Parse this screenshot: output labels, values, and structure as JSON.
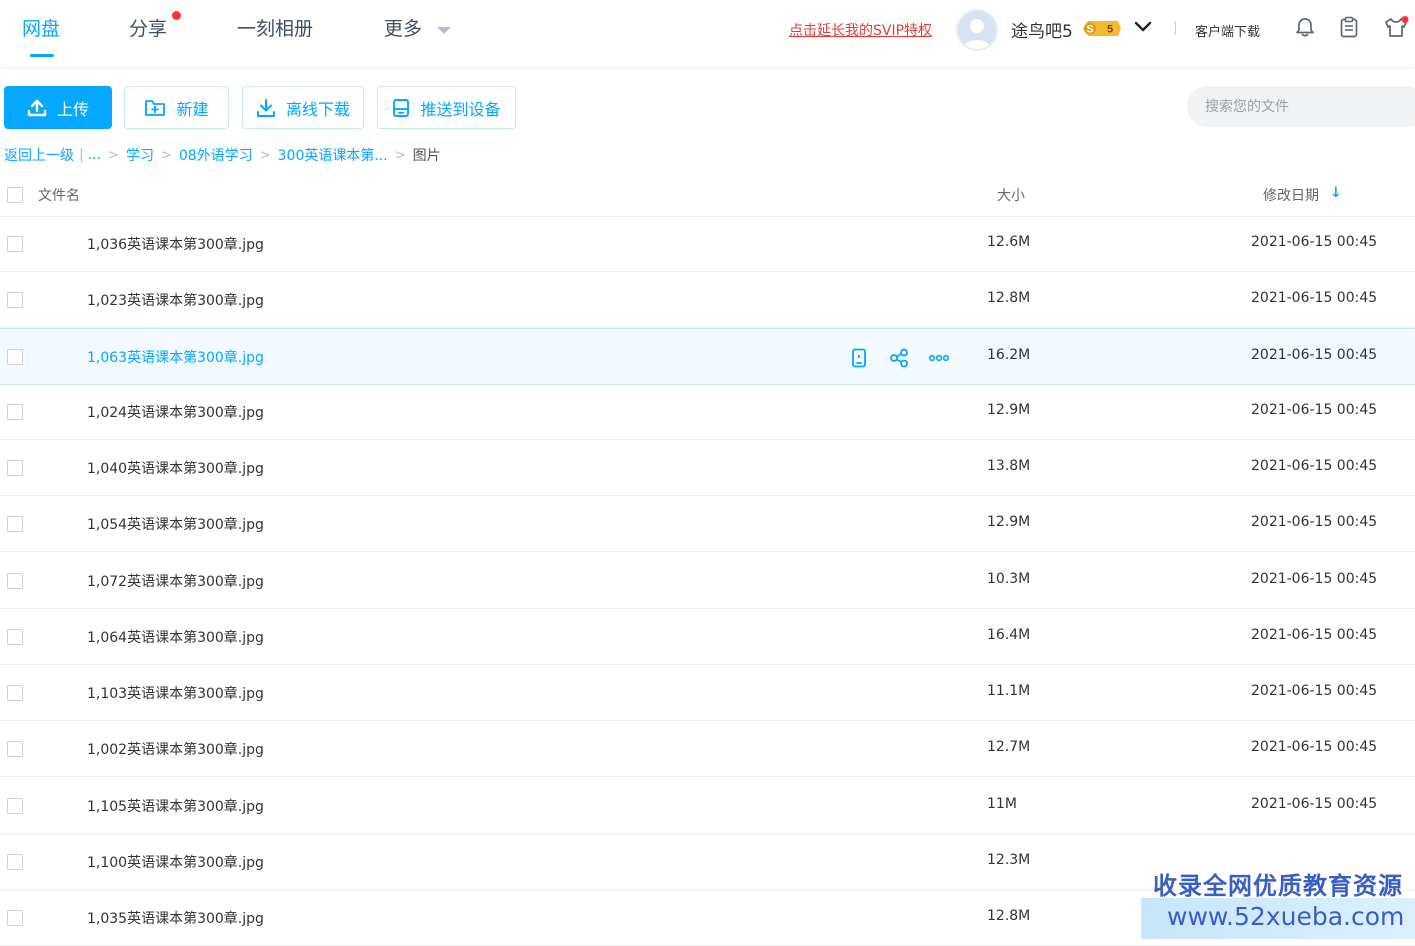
{
  "nav": {
    "tabs": [
      {
        "label": "网盘",
        "active": true
      },
      {
        "label": "分享",
        "has_dot": true
      },
      {
        "label": "一刻相册"
      },
      {
        "label": "更多",
        "has_caret": true
      }
    ]
  },
  "header": {
    "svip_link": "点击延长我的SVIP特权",
    "username": "途鸟吧5",
    "svip_badge": "S 5",
    "client_download": "客户端下载"
  },
  "toolbar": {
    "upload_label": "上传",
    "new_label": "新建",
    "offline_download_label": "离线下载",
    "push_device_label": "推送到设备",
    "search_placeholder": "搜索您的文件"
  },
  "breadcrumb": {
    "back_label": "返回上一级",
    "ellipsis": "...",
    "items": [
      "学习",
      "08外语学习",
      "300英语课本第..."
    ],
    "current": "图片"
  },
  "table": {
    "columns": {
      "name": "文件名",
      "size": "大小",
      "date": "修改日期"
    },
    "sort_indicator": "↓",
    "rows": [
      {
        "name": "1,036英语课本第300章.jpg",
        "size": "12.6M",
        "date": "2021-06-15 00:45"
      },
      {
        "name": "1,023英语课本第300章.jpg",
        "size": "12.8M",
        "date": "2021-06-15 00:45"
      },
      {
        "name": "1,063英语课本第300章.jpg",
        "size": "16.2M",
        "date": "2021-06-15 00:45",
        "hovered": true
      },
      {
        "name": "1,024英语课本第300章.jpg",
        "size": "12.9M",
        "date": "2021-06-15 00:45"
      },
      {
        "name": "1,040英语课本第300章.jpg",
        "size": "13.8M",
        "date": "2021-06-15 00:45"
      },
      {
        "name": "1,054英语课本第300章.jpg",
        "size": "12.9M",
        "date": "2021-06-15 00:45"
      },
      {
        "name": "1,072英语课本第300章.jpg",
        "size": "10.3M",
        "date": "2021-06-15 00:45"
      },
      {
        "name": "1,064英语课本第300章.jpg",
        "size": "16.4M",
        "date": "2021-06-15 00:45"
      },
      {
        "name": "1,103英语课本第300章.jpg",
        "size": "11.1M",
        "date": "2021-06-15 00:45"
      },
      {
        "name": "1,002英语课本第300章.jpg",
        "size": "12.7M",
        "date": "2021-06-15 00:45"
      },
      {
        "name": "1,105英语课本第300章.jpg",
        "size": "11M",
        "date": "2021-06-15 00:45"
      },
      {
        "name": "1,100英语课本第300章.jpg",
        "size": "12.3M",
        "date": ""
      },
      {
        "name": "1,035英语课本第300章.jpg",
        "size": "12.8M",
        "date": ""
      }
    ]
  },
  "watermark": {
    "line1": "收录全网优质教育资源",
    "line2": "www.52xueba.com"
  },
  "colors": {
    "accent": "#06a7ff",
    "svip_link": "#e23c3c",
    "watermark_text": "#3a5fc4"
  }
}
